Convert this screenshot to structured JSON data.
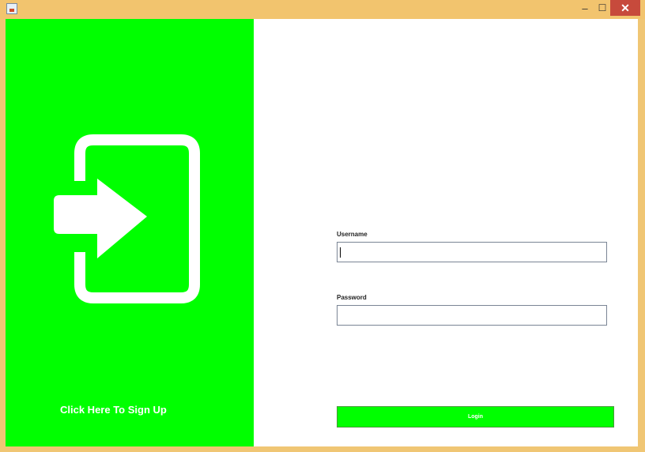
{
  "window": {
    "minimize_glyph": "‒",
    "maximize_glyph": "☐",
    "close_glyph": "✕"
  },
  "left_panel": {
    "signup_text": "Click Here To Sign Up",
    "background_color": "#00ff00",
    "icon": "sign-in-icon"
  },
  "form": {
    "username_label": "Username",
    "username_value": "",
    "password_label": "Password",
    "password_value": "",
    "login_label": "Login",
    "accent_color": "#00ff00"
  }
}
